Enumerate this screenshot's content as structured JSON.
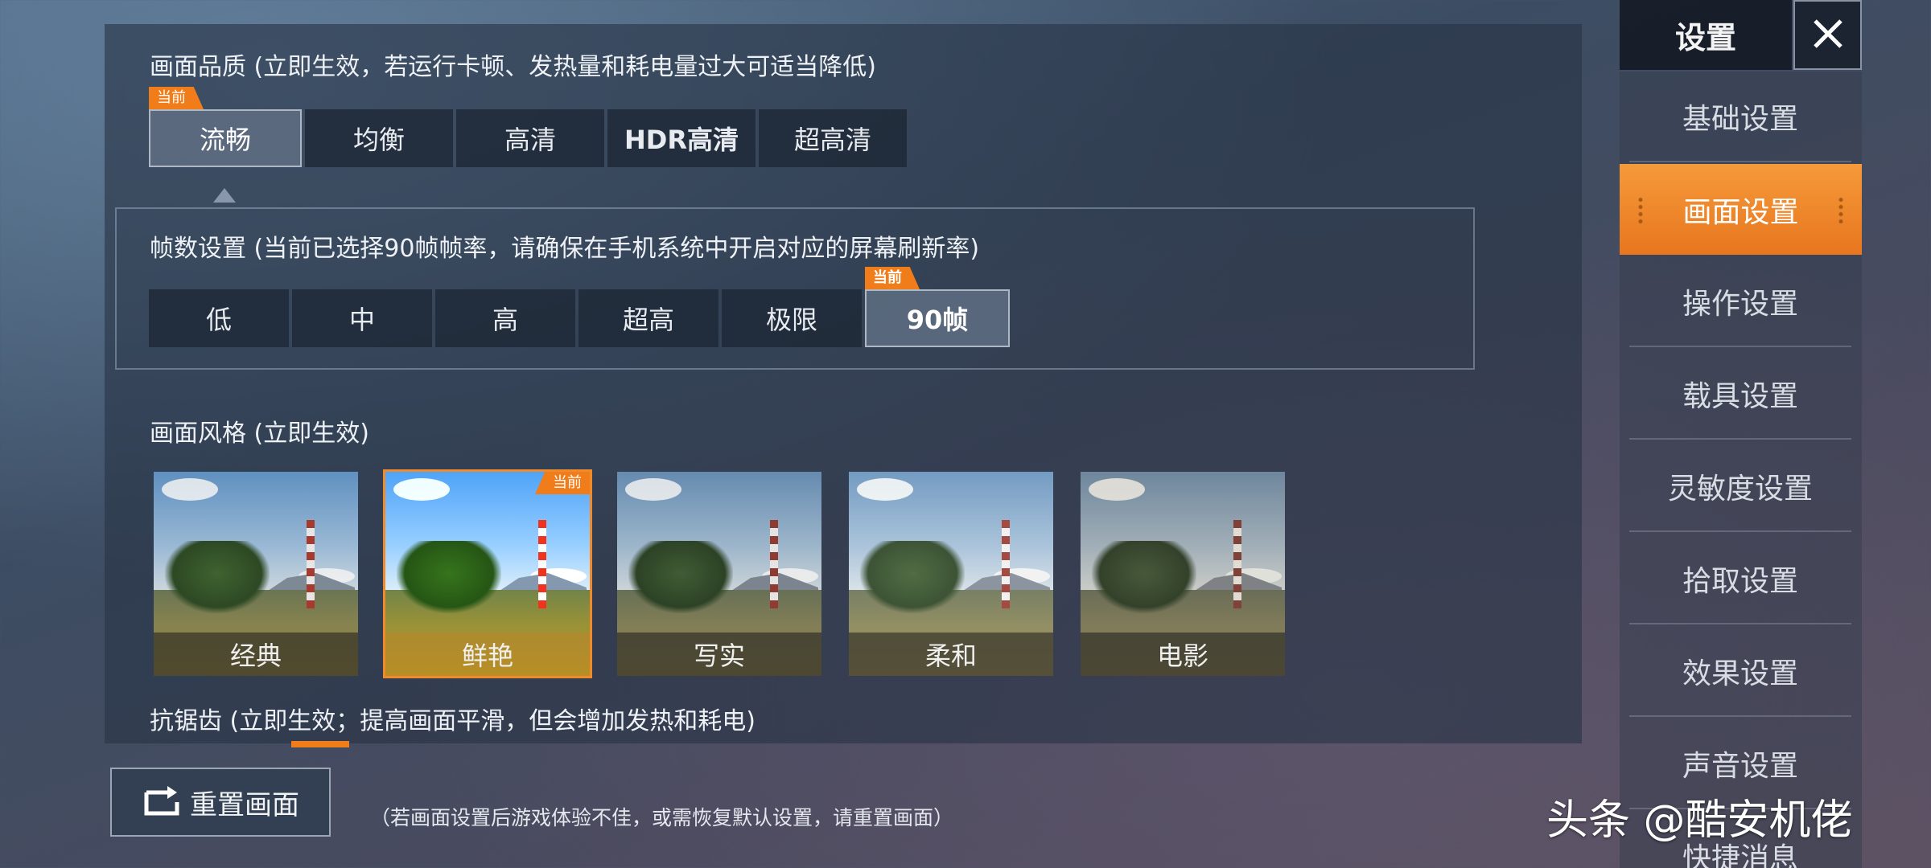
{
  "quality": {
    "title": "画面品质 (立即生效，若运行卡顿、发热量和耗电量过大可适当降低)",
    "current_tag": "当前",
    "options": [
      "流畅",
      "均衡",
      "高清",
      "HDR高清",
      "超高清"
    ],
    "selected": "流畅"
  },
  "fps": {
    "title": "帧数设置 (当前已选择90帧帧率，请确保在手机系统中开启对应的屏幕刷新率)",
    "current_tag": "当前",
    "options": [
      "低",
      "中",
      "高",
      "超高",
      "极限",
      "90帧"
    ],
    "selected": "90帧"
  },
  "style": {
    "title": "画面风格 (立即生效)",
    "current_tag": "当前",
    "options": [
      "经典",
      "鲜艳",
      "写实",
      "柔和",
      "电影"
    ],
    "selected": "鲜艳"
  },
  "antialias": {
    "title": "抗锯齿 (立即生效；提高画面平滑，但会增加发热和耗电)"
  },
  "reset": {
    "label": "重置画面",
    "note": "（若画面设置后游戏体验不佳，或需恢复默认设置，请重置画面）"
  },
  "sidebar": {
    "title": "设置",
    "close_icon": "close-icon",
    "active": "画面设置",
    "items": [
      "基础设置",
      "画面设置",
      "操作设置",
      "载具设置",
      "灵敏度设置",
      "拾取设置",
      "效果设置",
      "声音设置",
      "快捷消息"
    ]
  },
  "watermark": "头条 @酷安机佬",
  "colors": {
    "accent": "#f07c1a",
    "active_tab": "#f0872a"
  }
}
